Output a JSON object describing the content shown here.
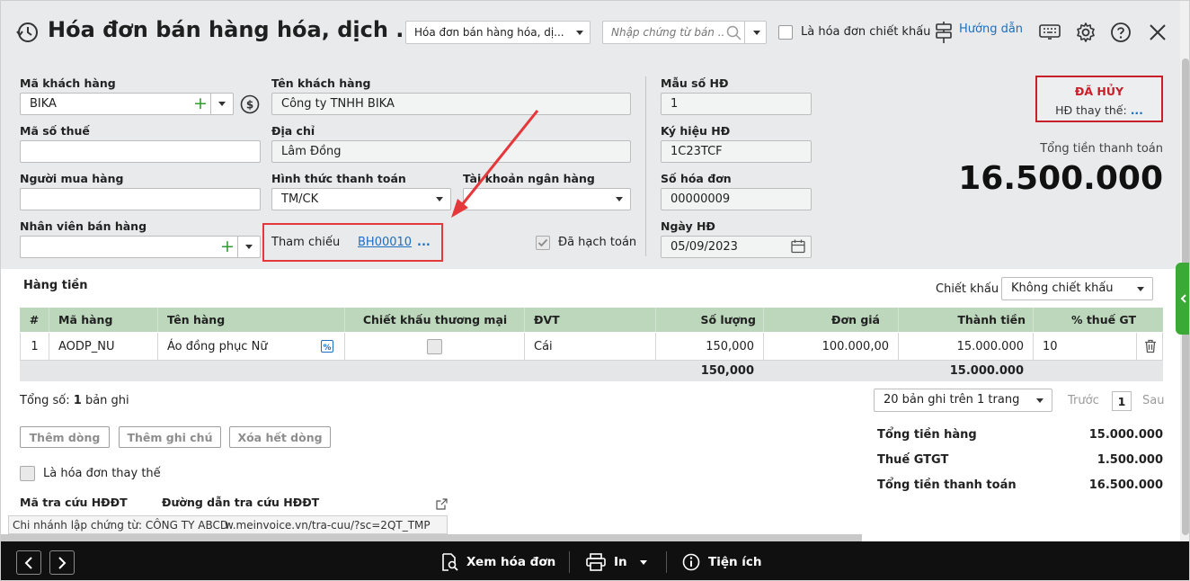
{
  "window": {
    "title": "Hóa đơn bán hàng hóa, dịch ..."
  },
  "header": {
    "invoice_type_select": "Hóa đơn bán hàng hóa, dị...",
    "voucher_search_placeholder": "Nhập chứng từ bán ...",
    "discount_invoice_label": "Là hóa đơn chiết khấu",
    "guide_label": "Hướng dẫn"
  },
  "form": {
    "customer_code_label": "Mã khách hàng",
    "customer_code_value": "BIKA",
    "customer_name_label": "Tên khách hàng",
    "customer_name_value": "Công ty TNHH BIKA",
    "tax_code_label": "Mã số thuế",
    "tax_code_value": "",
    "address_label": "Địa chỉ",
    "address_value": "Lâm Đồng",
    "buyer_label": "Người mua hàng",
    "buyer_value": "",
    "payment_method_label": "Hình thức thanh toán",
    "payment_method_value": "TM/CK",
    "bank_account_label": "Tài khoản ngân hàng",
    "bank_account_value": "",
    "salesperson_label": "Nhân viên bán hàng",
    "salesperson_value": "",
    "reference_label": "Tham chiếu",
    "reference_value": "BH00010",
    "reference_more": "...",
    "posted_label": "Đã hạch toán",
    "template_label": "Mẫu số HĐ",
    "template_value": "1",
    "symbol_label": "Ký hiệu HĐ",
    "symbol_value": "1C23TCF",
    "invoice_no_label": "Số hóa đơn",
    "invoice_no_value": "00000009",
    "invoice_date_label": "Ngày HĐ",
    "invoice_date_value": "05/09/2023"
  },
  "status": {
    "label": "ĐÃ HỦY",
    "replacement_label": "HĐ thay thế:",
    "replacement_link": "..."
  },
  "totals_header": {
    "label": "Tổng tiền thanh toán",
    "value": "16.500.000"
  },
  "items_section": {
    "title": "Hàng tiền",
    "discount_label": "Chiết khấu",
    "discount_value": "Không chiết khấu",
    "columns": [
      "#",
      "Mã hàng",
      "Tên hàng",
      "Chiết khấu thương mại",
      "ĐVT",
      "Số lượng",
      "Đơn giá",
      "Thành tiền",
      "% thuế GT"
    ],
    "rows": [
      {
        "no": "1",
        "code": "AODP_NU",
        "name": "Áo đồng phục Nữ",
        "unit": "Cái",
        "qty": "150,000",
        "price": "100.000,00",
        "amount": "15.000.000",
        "vat": "10"
      }
    ],
    "footer": {
      "qty_total": "150,000",
      "amount_total": "15.000.000"
    }
  },
  "pagination": {
    "total_prefix": "Tổng số:",
    "total_count": "1",
    "total_suffix": "bản ghi",
    "page_size": "20 bản ghi trên 1 trang",
    "prev": "Trước",
    "page": "1",
    "next": "Sau"
  },
  "actions": {
    "add_row": "Thêm dòng",
    "add_note": "Thêm ghi chú",
    "delete_all": "Xóa hết dòng"
  },
  "replacement_invoice_label": "Là hóa đơn thay thế",
  "einvoice": {
    "lookup_code_label": "Mã tra cứu HĐĐT",
    "lookup_url_label": "Đường dẫn tra cứu HĐĐT",
    "lookup_url_value": "w.meinvoice.vn/tra-cuu/?sc=2QT_TMP"
  },
  "branch_tooltip": "Chi nhánh lập chứng từ: CÔNG TY ABCD",
  "summary": [
    {
      "label": "Tổng tiền hàng",
      "value": "15.000.000"
    },
    {
      "label": "Thuế GTGT",
      "value": "1.500.000"
    },
    {
      "label": "Tổng tiền thanh toán",
      "value": "16.500.000"
    }
  ],
  "bottom_bar": {
    "view_invoice": "Xem hóa đơn",
    "print": "In",
    "utilities": "Tiện ích"
  },
  "colors": {
    "header_bg": "#e8eaeb",
    "grid_header": "#bcd7bb",
    "link": "#1e6fbf",
    "status_red": "#c8202a",
    "annotation_red": "#e5383b",
    "bottom_bar": "#101010"
  }
}
